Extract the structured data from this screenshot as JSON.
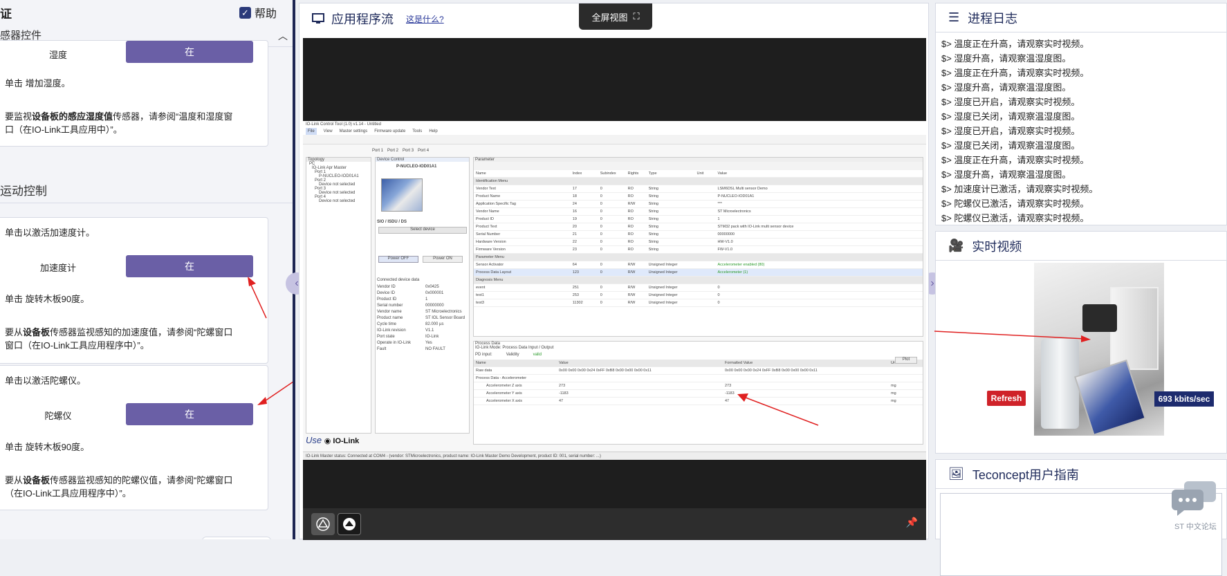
{
  "left": {
    "title": "证",
    "help_label": "帮助",
    "help_checked": true,
    "sensor_section": "感器控件",
    "humidity": {
      "label": "湿度",
      "button": "在",
      "hint1": "单击 增加湿度。",
      "hint2a": "要监视",
      "hint2b": "设备板的感应湿度值",
      "hint2c": "传感器，请参阅“温度和湿度窗",
      "hint2d": "口（在IO-Link工具应用中）”。"
    },
    "motion_title": "运动控制",
    "accelerometer": {
      "intro": "单击以激活加速度计。",
      "label": "加速度计",
      "button": "在",
      "hint1": "单击 旋转木板90度。",
      "hint2a": "要从",
      "hint2b": "设备板",
      "hint2c": "传感器监视感知的加速度值，请参阅“陀螺窗口",
      "hint2d": "窗口（在IO-Link工具应用程序中）”。"
    },
    "gyroscope": {
      "intro": "单击以激活陀螺仪。",
      "label": "陀螺仪",
      "button": "在",
      "hint1": "单击 旋转木板90度。",
      "hint2a": "要从",
      "hint2b": "设备板",
      "hint2c": "传感器监视感知的陀螺仪值，请参阅“陀螺窗口",
      "hint2d": "（在IO-Link工具应用程序中）”。"
    }
  },
  "middle": {
    "title": "应用程序流",
    "what_link": "这是什么?",
    "fullscreen": "全屏视图",
    "app": {
      "window_title": "IO-Link Control Tool (1.0) v1.14 - Untitled",
      "menu": [
        "File",
        "View",
        "Master settings",
        "Firmware update",
        "Tools",
        "Help"
      ],
      "tree_title": "Topology",
      "tree_items": [
        "PC",
        "IO-Link Apr Master",
        "Port 1",
        "P-NUCLEO-IOD01A1",
        "Port 2",
        "Device not selected",
        "Port 3",
        "Device not selected",
        "Port 4",
        "Device not selected"
      ],
      "device_panel": "Device Control",
      "device_name": "P-NUCLEO-IOD01A1",
      "sio_label": "SIO / ISDU / DS",
      "select_device": "Select device",
      "power_off": "Power OFF",
      "power_on": "Power ON",
      "connected_label": "Connected device data",
      "device_data": [
        [
          "Vendor ID",
          "0x0425"
        ],
        [
          "Device ID",
          "0x000001"
        ],
        [
          "Product ID",
          "1"
        ],
        [
          "Serial number",
          "00000000"
        ],
        [
          "Vendor name",
          "ST Microelectronics"
        ],
        [
          "Product name",
          "ST IOL Sensor Board"
        ],
        [
          "Cycle time",
          "82.000 µs"
        ],
        [
          "IO-Link revision",
          "V1.1"
        ],
        [
          "Port state",
          "IO-Link"
        ],
        [
          "Operate in IO-Link",
          "Yes"
        ],
        [
          "Fault",
          "NO FAULT"
        ]
      ],
      "params_title": "Parameter",
      "params_cols": [
        "Name",
        "Index",
        "Subindex",
        "Rights",
        "Type",
        "Unit",
        "Value"
      ],
      "params_rows": [
        {
          "g": true,
          "cells": [
            "Identification Menu"
          ]
        },
        {
          "cells": [
            "Vendor Text",
            "17",
            "0",
            "RO",
            "String",
            "",
            "LSM6DSL Multi sensor Demo"
          ]
        },
        {
          "cells": [
            "Product Name",
            "18",
            "0",
            "RO",
            "String",
            "",
            "P-NUCLEO-IOD01A1"
          ]
        },
        {
          "cells": [
            "Application Specific Tag",
            "24",
            "0",
            "R/W",
            "String",
            "",
            "***"
          ]
        },
        {
          "cells": [
            "Vendor Name",
            "16",
            "0",
            "RO",
            "String",
            "",
            "ST Microelectronics"
          ]
        },
        {
          "cells": [
            "Product ID",
            "19",
            "0",
            "RO",
            "String",
            "",
            "1"
          ]
        },
        {
          "cells": [
            "Product Text",
            "20",
            "0",
            "RO",
            "String",
            "",
            "STM32 pack with IO-Link multi sensor device"
          ]
        },
        {
          "cells": [
            "Serial Number",
            "21",
            "0",
            "RO",
            "String",
            "",
            "00000000"
          ]
        },
        {
          "cells": [
            "Hardware Version",
            "22",
            "0",
            "RO",
            "String",
            "",
            "HW-V1.0"
          ]
        },
        {
          "cells": [
            "Firmware Version",
            "23",
            "0",
            "RO",
            "String",
            "",
            "FW-V1.0"
          ]
        },
        {
          "g": true,
          "cells": [
            "Parameter Menu"
          ]
        },
        {
          "cells": [
            "Sensor Activator",
            "64",
            "0",
            "R/W",
            "Unsigned Integer",
            "",
            "Accelerometer enabled (80)"
          ]
        },
        {
          "h": true,
          "cells": [
            "Process Data Layout",
            "123",
            "0",
            "R/W",
            "Unsigned Integer",
            "",
            "Accelerometer (1)"
          ]
        },
        {
          "g": true,
          "cells": [
            "Diagnosis Menu"
          ]
        },
        {
          "cells": [
            "event",
            "251",
            "0",
            "R/W",
            "Unsigned Integer",
            "",
            "0"
          ]
        },
        {
          "cells": [
            "test1",
            "253",
            "0",
            "R/W",
            "Unsigned Integer",
            "",
            "0"
          ]
        },
        {
          "cells": [
            "test3",
            "11302",
            "0",
            "R/W",
            "Unsigned Integer",
            "",
            "0"
          ]
        }
      ],
      "pd_title": "Process Data",
      "pd_mode": "IO-Link Mode: Process Data Input / Output",
      "pd_input": "PD input:",
      "pd_validity": "Validity",
      "pd_valid": "valid",
      "pd_plot": "Plot",
      "pd_cols": [
        "Name",
        "Value",
        "Formatted Value",
        "Unit"
      ],
      "pd_rows": [
        [
          "Raw data",
          "0x00 0x00 0x00 0x24 0xFF 0xB8 0x00 0x00 0x00 0x11",
          "0x00 0x00 0x00 0x24 0xFF 0xB8 0x00 0x00 0x00 0x11",
          ""
        ],
        [
          "Process Data - Accelerometer",
          "",
          "",
          ""
        ],
        [
          "Accelerometer Z axis",
          "273",
          "273",
          "mg"
        ],
        [
          "Accelerometer Y axis",
          "-1183",
          "-1183",
          "mg"
        ],
        [
          "Accelerometer X axis",
          "47",
          "47",
          "mg"
        ]
      ],
      "status": "IO-Link Master status: Connected at COM4 - (vendor: STMicroelectronics, product name: IO-Link Master Demo Development, product ID: 001, serial number: ...)"
    }
  },
  "right": {
    "log_title": "进程日志",
    "log_lines": [
      "$> 温度正在升高，请观察实时视频。",
      "$> 湿度升高，请观察温湿度图。",
      "$> 温度正在升高，请观察实时视频。",
      "$> 湿度升高，请观察温湿度图。",
      "$> 湿度已开启，请观察实时视频。",
      "$> 湿度已关闭，请观察温湿度图。",
      "$> 湿度已开启，请观察实时视频。",
      "$> 湿度已关闭，请观察温湿度图。",
      "$> 温度正在升高，请观察实时视频。",
      "$> 湿度升高，请观察温湿度图。",
      "$> 加速度计已激活，请观察实时视频。",
      "$> 陀螺仪已激活，请观察实时视频。",
      "$> 陀螺仪已激活，请观察实时视频。"
    ],
    "video_title": "实时视频",
    "refresh": "Refresh",
    "bitrate": "693 kbits/sec",
    "guide_title": "Teconcept用户指南",
    "forum_label": "ST 中文论坛"
  },
  "colors": {
    "accent_purple": "#6a5fa6",
    "navy": "#1e2a5a",
    "refresh_red": "#cf2229",
    "arrow_red": "#e02020"
  }
}
